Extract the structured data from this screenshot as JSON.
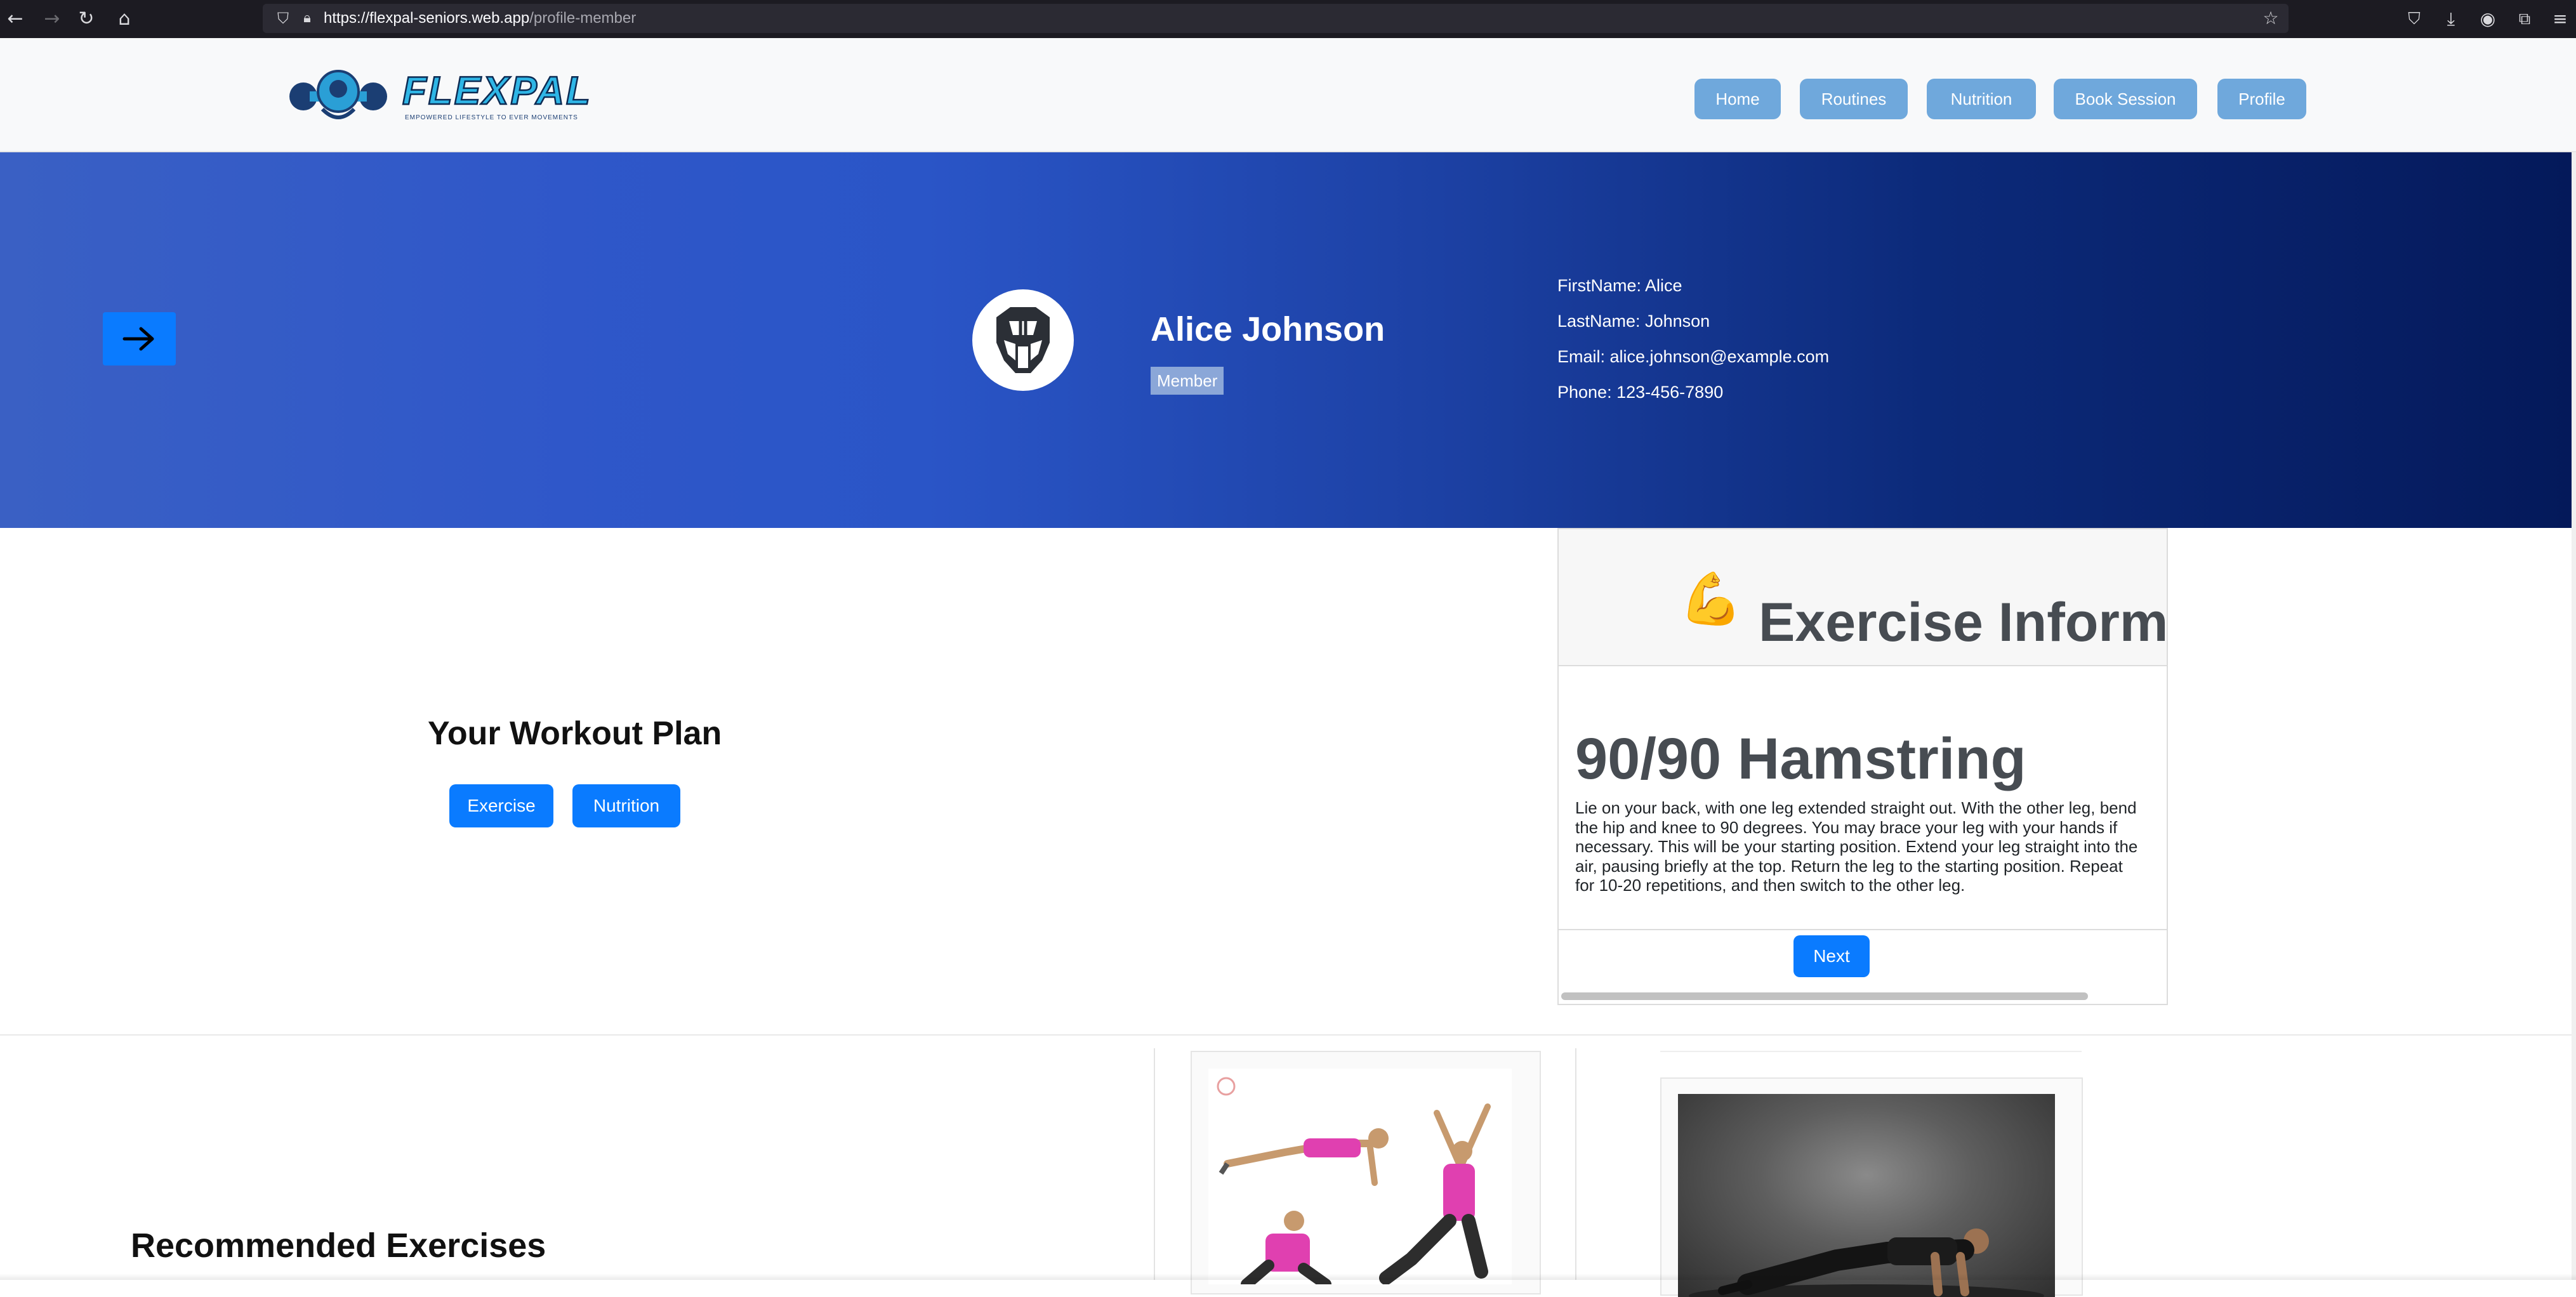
{
  "browser": {
    "url_host": "https://flexpal-seniors.web.app",
    "url_path": "/profile-member",
    "icons": [
      "back-icon",
      "forward-icon",
      "reload-icon",
      "home-icon",
      "shield-icon",
      "lock-icon",
      "bookmark-star-icon",
      "pocket-icon",
      "download-icon",
      "account-icon",
      "extensions-icon",
      "menu-icon"
    ]
  },
  "brand": {
    "name": "FLEXPAL",
    "tagline": "EMPOWERED LIFESTYLE TO EVER MOVEMENTS"
  },
  "nav": {
    "items": [
      "Home",
      "Routines",
      "Nutrition",
      "Book Session",
      "Profile"
    ]
  },
  "profile": {
    "name": "Alice Johnson",
    "role": "Member",
    "first_name_line": "FirstName: Alice",
    "last_name_line": "LastName: Johnson",
    "email_line": "Email: alice.johnson@example.com",
    "phone_line": "Phone: 123-456-7890"
  },
  "workout_plan": {
    "title": "Your Workout Plan",
    "buttons": [
      "Exercise",
      "Nutrition"
    ]
  },
  "exercise_card": {
    "emoji": "💪",
    "header": "Exercise Informat",
    "name": "90/90 Hamstring",
    "description": "Lie on your back, with one leg extended straight out. With the other leg, bend the hip and knee to 90 degrees. You may brace your leg with your hands if necessary. This will be your starting position. Extend your leg straight into the air, pausing briefly at the top. Return the leg to the starting position. Repeat for 10-20 repetitions, and then switch to the other leg.",
    "next_label": "Next"
  },
  "recommended": {
    "title": "Recommended Exercises"
  },
  "colors": {
    "accent_blue": "#0a7bff",
    "nav_button": "#6fa8dc",
    "hero_start": "#3a60c4",
    "hero_end": "#04195a"
  }
}
